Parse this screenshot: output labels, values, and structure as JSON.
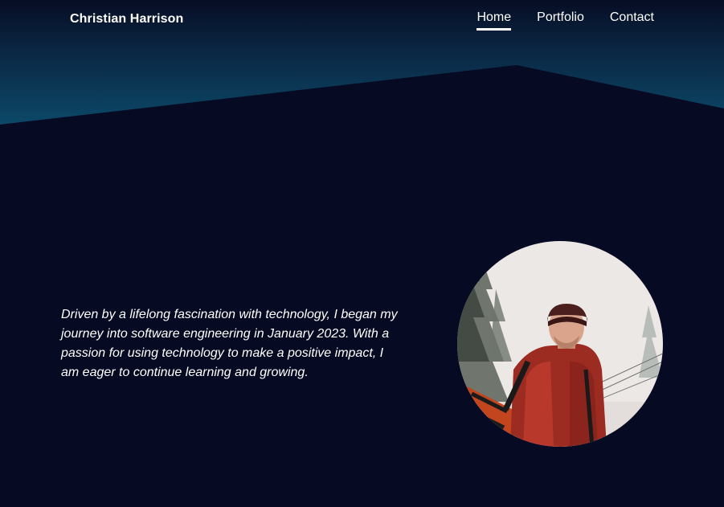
{
  "header": {
    "brand": "Christian Harrison",
    "nav": [
      {
        "label": "Home",
        "active": true
      },
      {
        "label": "Portfolio",
        "active": false
      },
      {
        "label": "Contact",
        "active": false
      }
    ]
  },
  "hero": {
    "bio": "Driven by a lifelong fascination with technology, I began my journey into software engineering in January 2023. With a passion for using technology to make a positive impact, I am eager to continue learning and growing.",
    "photo": "profile-photo"
  },
  "colors": {
    "background": "#060a22",
    "gradient_top": "#070d24",
    "gradient_bottom": "#0c4a6a",
    "text": "#ffffff"
  }
}
